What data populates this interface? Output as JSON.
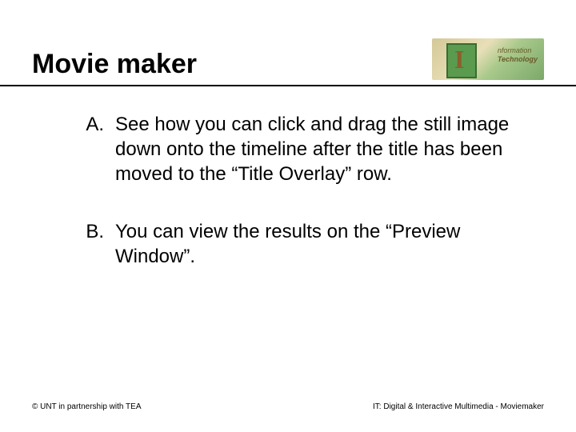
{
  "header": {
    "title": "Movie maker",
    "logo": {
      "line1": "nformation",
      "line2": "Technology",
      "icon_name": "info-tech-logo"
    }
  },
  "content": {
    "items": [
      {
        "marker": "A.",
        "text": "See how you can click and drag the still image down onto the timeline after the title has been moved to the “Title Overlay” row."
      },
      {
        "marker": "B.",
        "text": "You can view the results on the “Preview Window”."
      }
    ]
  },
  "footer": {
    "left": "© UNT in partnership with TEA",
    "right": "IT: Digital & Interactive Multimedia - Moviemaker"
  }
}
